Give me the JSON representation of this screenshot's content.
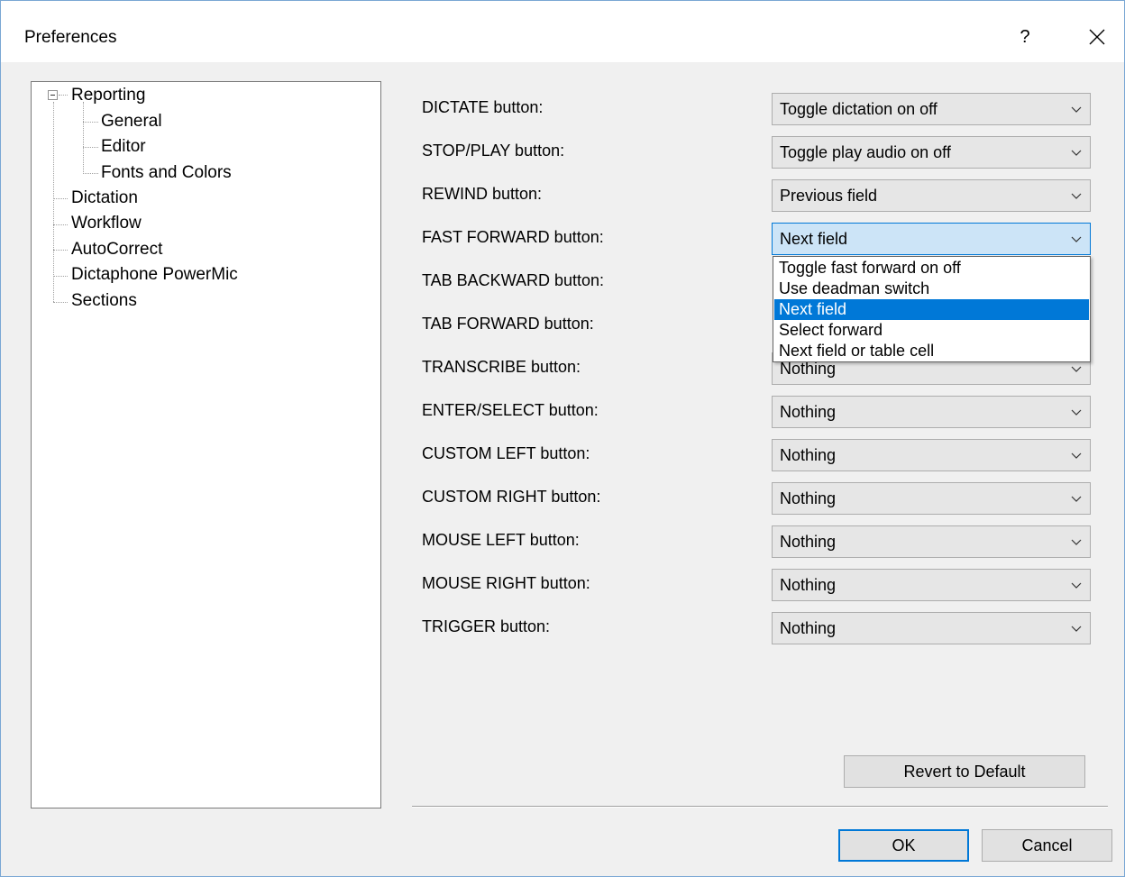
{
  "window": {
    "title": "Preferences",
    "help_label": "?"
  },
  "tree": {
    "root": "Reporting",
    "children": [
      "General",
      "Editor",
      "Fonts and Colors"
    ],
    "items": [
      "Dictation",
      "Workflow",
      "AutoCorrect",
      "Dictaphone PowerMic",
      "Sections"
    ]
  },
  "buttons_config": [
    {
      "label": "DICTATE button:",
      "value": "Toggle dictation on off"
    },
    {
      "label": "STOP/PLAY button:",
      "value": "Toggle play audio on off"
    },
    {
      "label": "REWIND button:",
      "value": "Previous field"
    },
    {
      "label": "FAST FORWARD button:",
      "value": "Next field"
    },
    {
      "label": "TAB BACKWARD button:",
      "value": ""
    },
    {
      "label": "TAB FORWARD button:",
      "value": ""
    },
    {
      "label": "TRANSCRIBE button:",
      "value": "Nothing"
    },
    {
      "label": "ENTER/SELECT button:",
      "value": "Nothing"
    },
    {
      "label": "CUSTOM LEFT button:",
      "value": "Nothing"
    },
    {
      "label": "CUSTOM RIGHT button:",
      "value": "Nothing"
    },
    {
      "label": "MOUSE LEFT button:",
      "value": "Nothing"
    },
    {
      "label": "MOUSE RIGHT button:",
      "value": "Nothing"
    },
    {
      "label": "TRIGGER button:",
      "value": "Nothing"
    }
  ],
  "dropdown_options": [
    "Toggle fast forward on off",
    "Use deadman switch",
    "Next field",
    "Select forward",
    "Next field or table cell"
  ],
  "actions": {
    "revert": "Revert to Default",
    "ok": "OK",
    "cancel": "Cancel"
  },
  "colors": {
    "accent": "#0078d7",
    "combo_bg": "#e6e6e6",
    "focus_bg": "#cce4f7"
  }
}
